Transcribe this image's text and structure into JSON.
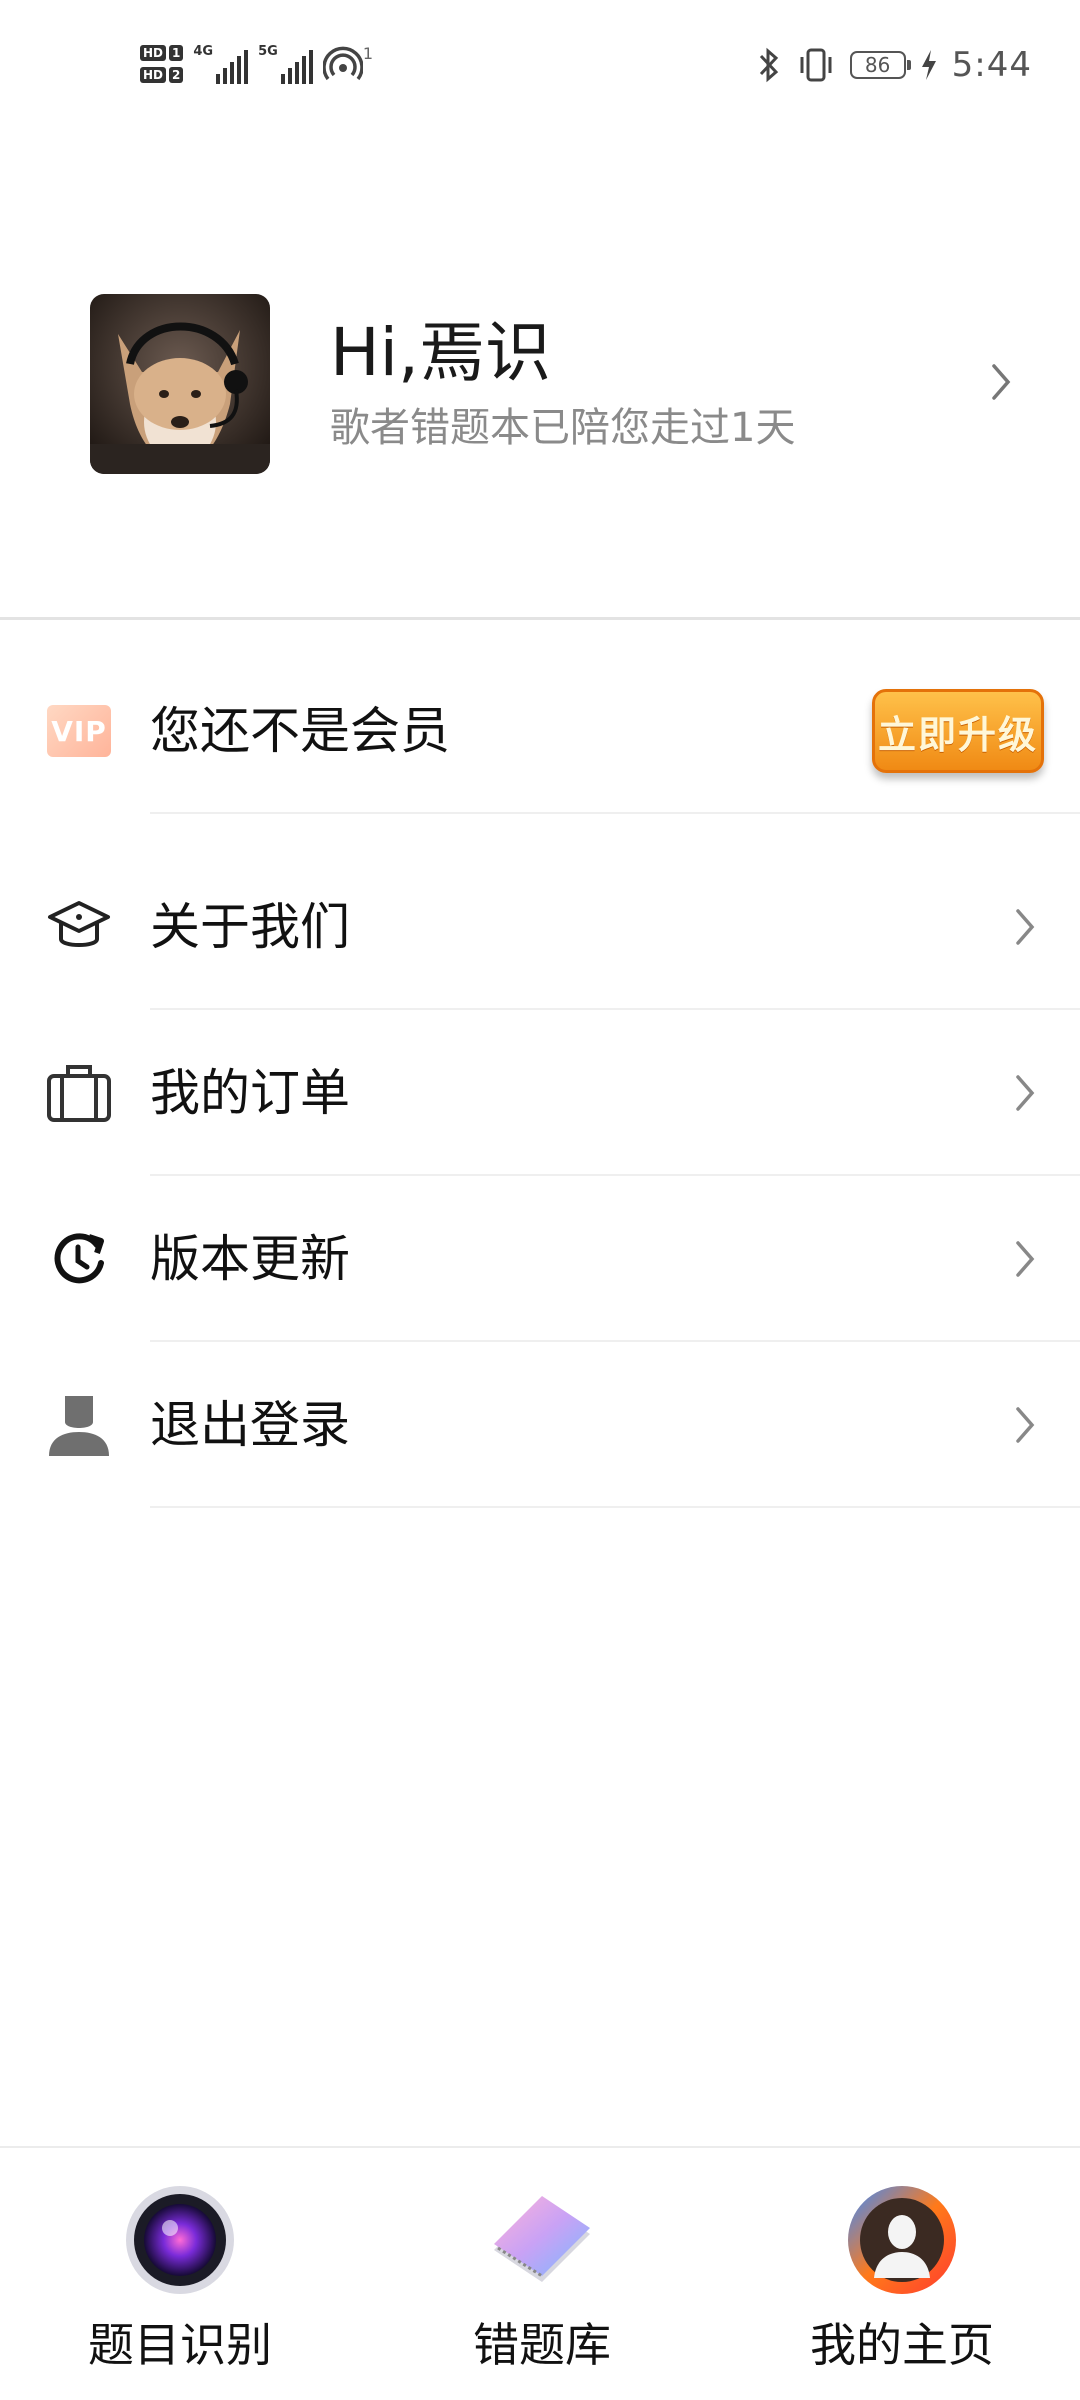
{
  "status_bar": {
    "sim1": "HD",
    "sim1_slot": "1",
    "sim2": "HD",
    "sim2_slot": "2",
    "network1": "4G",
    "network2": "5G",
    "hotspot_count": "1",
    "battery": "86",
    "time": "5:44",
    "icons": [
      "bluetooth-icon",
      "vibrate-icon",
      "battery-icon",
      "charging-icon"
    ]
  },
  "profile": {
    "greeting": "Hi,焉识",
    "subtitle": "歌者错题本已陪您走过1天"
  },
  "vip": {
    "badge": "VIP",
    "label": "您还不是会员",
    "button": "立即升级"
  },
  "menu": {
    "items": [
      {
        "label": "关于我们",
        "icon": "graduation-cap-icon"
      },
      {
        "label": "我的订单",
        "icon": "briefcase-icon"
      },
      {
        "label": "版本更新",
        "icon": "refresh-clock-icon"
      },
      {
        "label": "退出登录",
        "icon": "user-icon"
      }
    ]
  },
  "bottom_nav": {
    "items": [
      {
        "label": "题目识别",
        "icon": "camera-lens-icon"
      },
      {
        "label": "错题库",
        "icon": "notebook-icon"
      },
      {
        "label": "我的主页",
        "icon": "profile-avatar-icon"
      }
    ]
  },
  "colors": {
    "accent_orange": "#f08a14",
    "vip_pink": "#ffb49a",
    "text_primary": "#111111",
    "text_secondary": "#8a8a8a"
  }
}
